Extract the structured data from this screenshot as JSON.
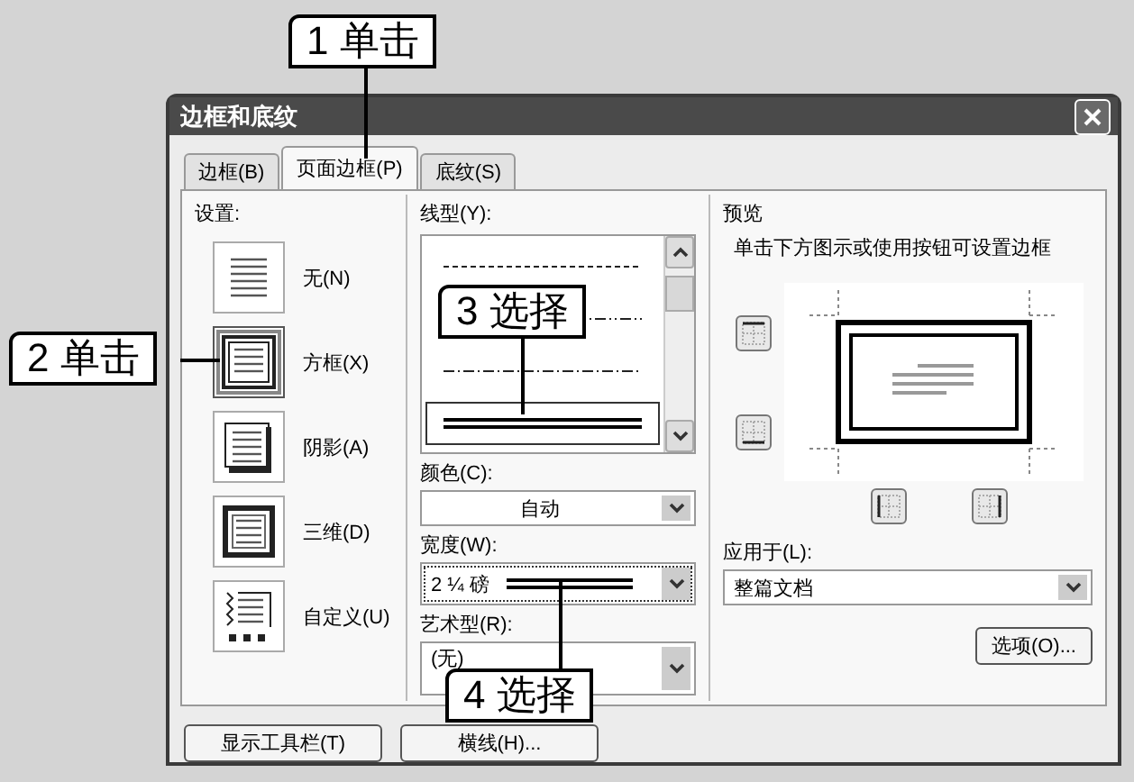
{
  "window": {
    "title": "边框和底纹"
  },
  "tabs": [
    {
      "label": "边框(B)",
      "selected": false
    },
    {
      "label": "页面边框(P)",
      "selected": true
    },
    {
      "label": "底纹(S)",
      "selected": false
    }
  ],
  "settings": {
    "label": "设置:",
    "items": [
      {
        "label": "无(N)",
        "kind": "none",
        "selected": false
      },
      {
        "label": "方框(X)",
        "kind": "box",
        "selected": true
      },
      {
        "label": "阴影(A)",
        "kind": "shadow",
        "selected": false
      },
      {
        "label": "三维(D)",
        "kind": "threed",
        "selected": false
      },
      {
        "label": "自定义(U)",
        "kind": "custom",
        "selected": false
      }
    ]
  },
  "line_style": {
    "label": "线型(Y):",
    "items": [
      {
        "kind": "dashed",
        "selected": false
      },
      {
        "kind": "dash-dot-dot",
        "selected": false
      },
      {
        "kind": "dash-dot",
        "selected": false
      },
      {
        "kind": "double",
        "selected": true
      }
    ]
  },
  "color": {
    "label": "颜色(C):",
    "value": "自动"
  },
  "width": {
    "label": "宽度(W):",
    "value": "2 ¼ 磅"
  },
  "art": {
    "label": "艺术型(R):",
    "value": "(无)"
  },
  "preview": {
    "title": "预览",
    "hint": "单击下方图示或使用按钮可设置边框"
  },
  "apply_to": {
    "label": "应用于(L):",
    "value": "整篇文档"
  },
  "options_button": "选项(O)...",
  "bottom_buttons": [
    "显示工具栏(T)",
    "横线(H)..."
  ],
  "callouts": [
    "1 单击",
    "2 单击",
    "3 选择",
    "4 选择"
  ]
}
